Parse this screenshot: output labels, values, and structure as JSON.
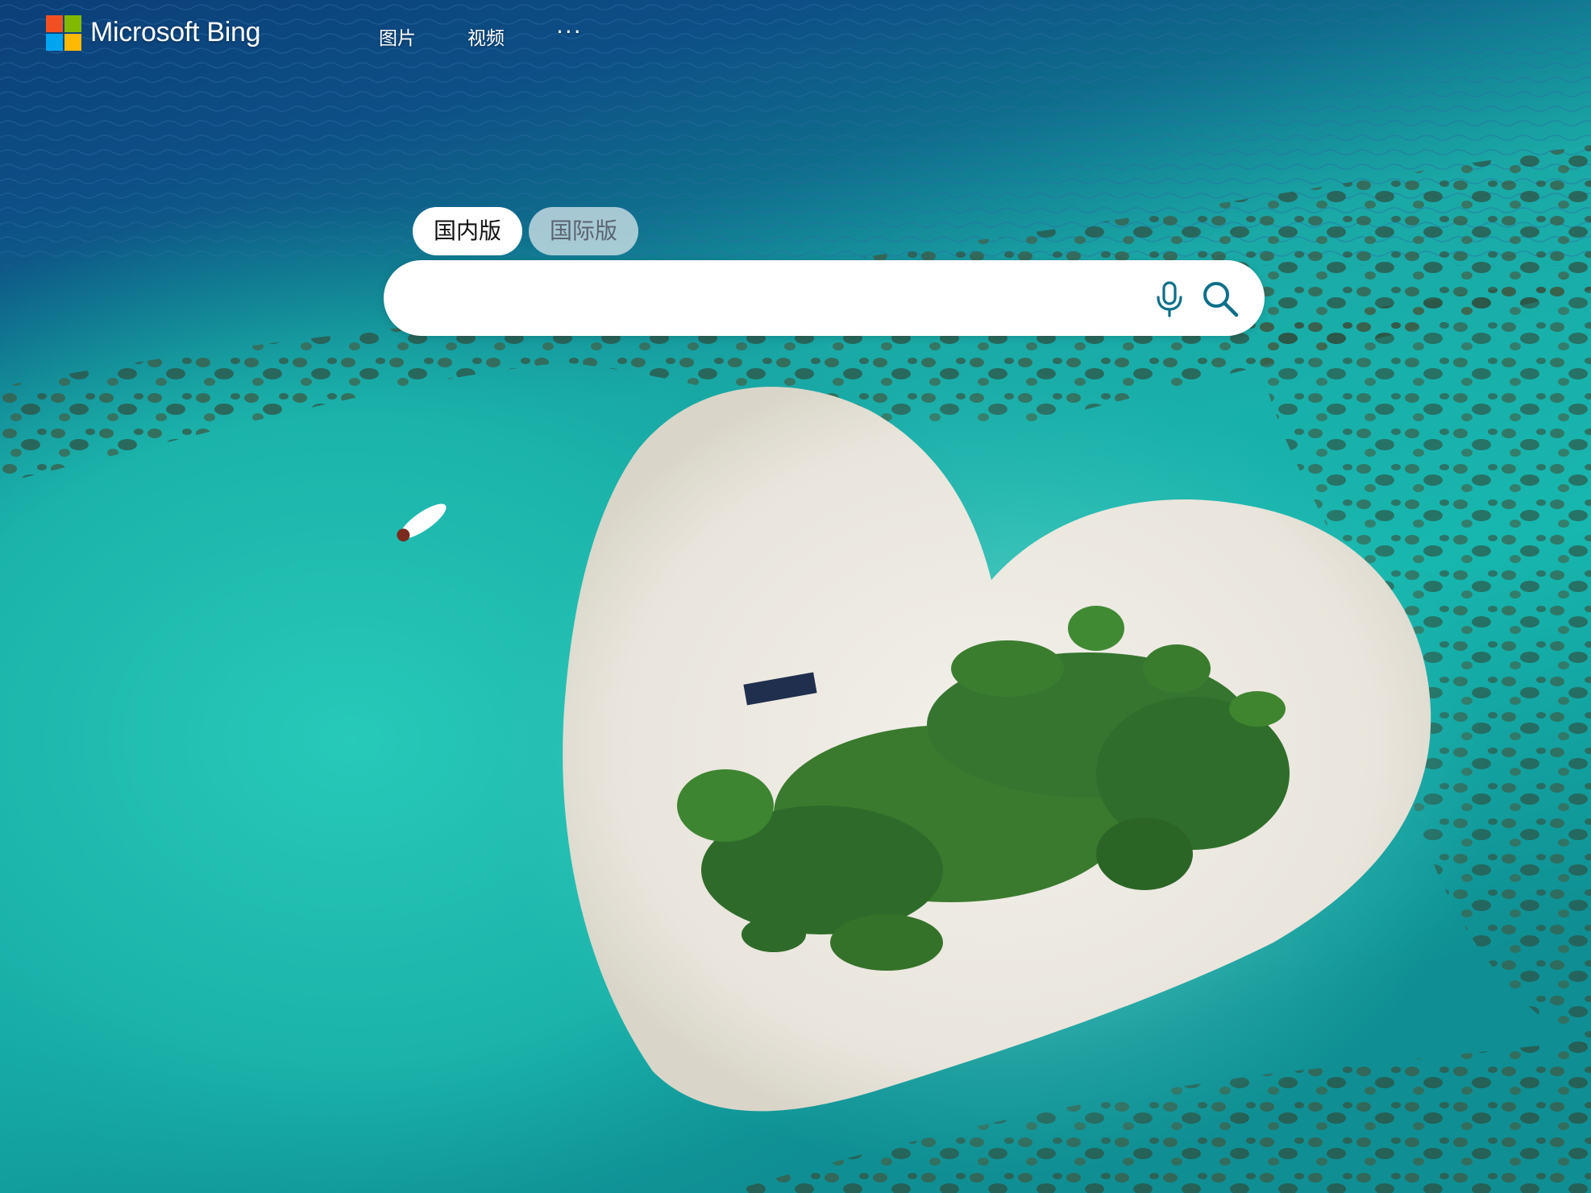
{
  "header": {
    "brand": "Microsoft Bing",
    "nav": {
      "images": "图片",
      "videos": "视频",
      "more": "···"
    }
  },
  "versions": {
    "domestic": "国内版",
    "international": "国际版",
    "selected": "domestic"
  },
  "search": {
    "value": "",
    "placeholder": ""
  },
  "colors": {
    "accent": "#0d6f89",
    "active_tab_bg": "#ffffff",
    "inactive_tab_bg": "#e1ebee"
  },
  "background": {
    "subject": "heart-shaped island aerial photo"
  }
}
